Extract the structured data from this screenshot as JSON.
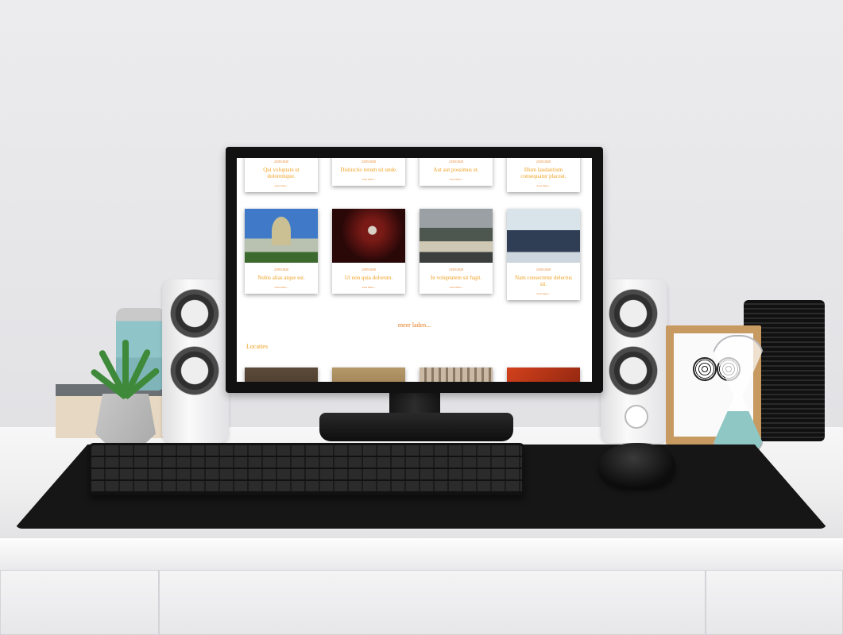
{
  "screen": {
    "top_row": [
      {
        "date": "23/05/2020",
        "title": "Qui voluptate ut doloremque.",
        "more": "Lees meer..."
      },
      {
        "date": "23/05/2020",
        "title": "Distinctio rerum sit unde.",
        "more": "Lees meer..."
      },
      {
        "date": "23/05/2020",
        "title": "Aut aut possimus et.",
        "more": "Lees meer..."
      },
      {
        "date": "23/05/2020",
        "title": "Illum laudantium consequatur placeat.",
        "more": "Lees meer..."
      }
    ],
    "middle_row": [
      {
        "date": "23/05/2020",
        "title": "Nobis alias atque est.",
        "more": "Lees meer...",
        "image": "dome-building"
      },
      {
        "date": "23/05/2020",
        "title": "Ut non quia dolorum.",
        "more": "Lees meer...",
        "image": "red-ornament"
      },
      {
        "date": "23/05/2020",
        "title": "In voluptatem sit fugit.",
        "more": "Lees meer...",
        "image": "office-meeting"
      },
      {
        "date": "23/05/2020",
        "title": "Nam consectetur delectus sit.",
        "more": "Lees meer...",
        "image": "group-people"
      }
    ],
    "load_more": "meer laden...",
    "section_title": "Locaties",
    "accent_color": "#e67e22",
    "title_color": "#f0a020"
  }
}
